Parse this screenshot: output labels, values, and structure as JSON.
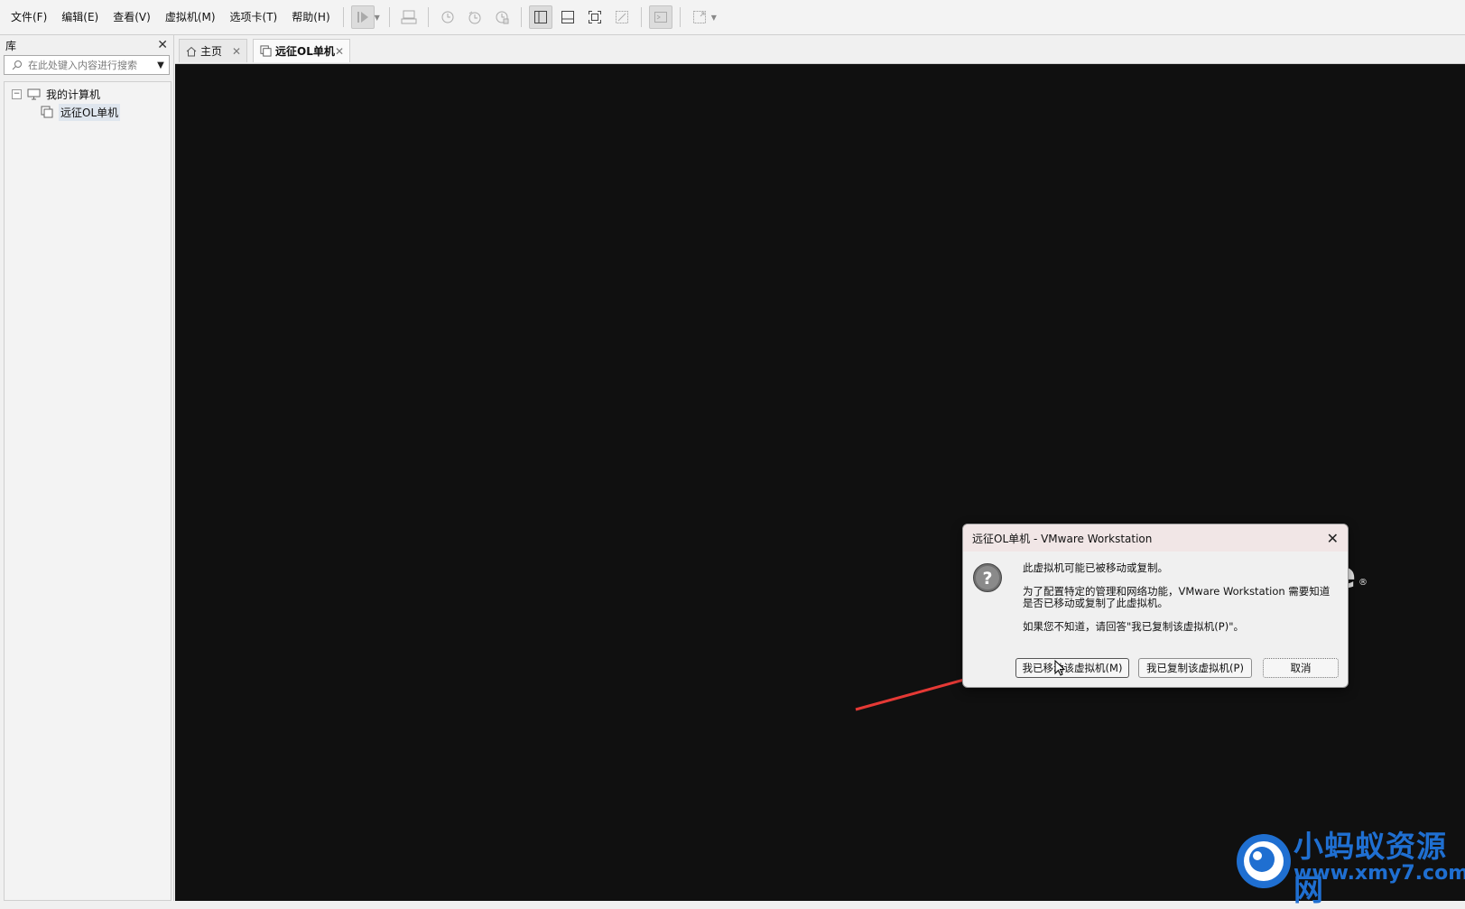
{
  "menu": [
    {
      "name": "menu-file",
      "label": "文件(F)"
    },
    {
      "name": "menu-edit",
      "label": "编辑(E)"
    },
    {
      "name": "menu-view",
      "label": "查看(V)"
    },
    {
      "name": "menu-vm",
      "label": "虚拟机(M)"
    },
    {
      "name": "menu-tabs",
      "label": "选项卡(T)"
    },
    {
      "name": "menu-help",
      "label": "帮助(H)"
    }
  ],
  "library": {
    "title": "库",
    "search_placeholder": "在此处键入内容进行搜索",
    "tree_root": "我的计算机",
    "tree_child": "远征OL单机"
  },
  "tabs": {
    "home": "主页",
    "vm": "远征OL单机"
  },
  "dialog": {
    "title": "远征OL单机 - VMware Workstation",
    "line1": "此虚拟机可能已被移动或复制。",
    "line2": "为了配置特定的管理和网络功能，VMware Workstation 需要知道是否已移动或复制了此虚拟机。",
    "line3": "如果您不知道，请回答\"我已复制该虚拟机(P)\"。",
    "btn_moved": "我已移动该虚拟机(M)",
    "btn_copied": "我已复制该虚拟机(P)",
    "btn_cancel": "取消"
  },
  "console": {
    "logo_fragment": "e",
    "registered": "®"
  },
  "watermark": {
    "name": "小蚂蚁资源网",
    "url": "www.xmy7.com"
  },
  "colors": {
    "console_bg": "#101010",
    "arrow": "#e53935",
    "watermark": "#1f6fd1"
  }
}
